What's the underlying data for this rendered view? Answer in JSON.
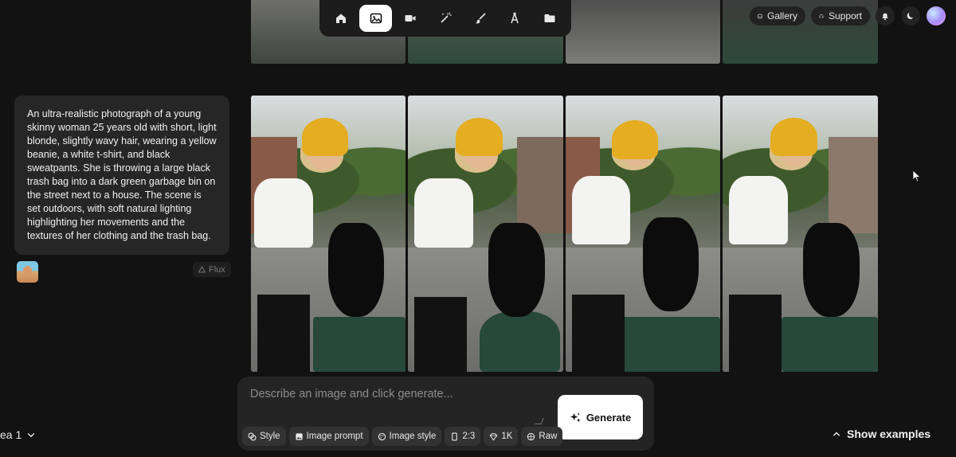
{
  "toolbar": {
    "tools": [
      {
        "name": "home",
        "icon": "home-icon",
        "active": false
      },
      {
        "name": "image",
        "icon": "image-icon",
        "active": true
      },
      {
        "name": "video",
        "icon": "video-icon",
        "active": false
      },
      {
        "name": "magic",
        "icon": "magic-wand-icon",
        "active": false
      },
      {
        "name": "brush",
        "icon": "brush-icon",
        "active": false
      },
      {
        "name": "text",
        "icon": "text-icon",
        "active": false
      },
      {
        "name": "folder",
        "icon": "folder-icon",
        "active": false
      }
    ]
  },
  "header": {
    "gallery_label": "Gallery",
    "support_label": "Support"
  },
  "prompt": {
    "text": "An ultra-realistic photograph of a young skinny woman 25 years old with short, light blonde, slightly wavy hair, wearing a yellow beanie, a white t-shirt, and black sweatpants. She is throwing a large black trash bag into a dark green garbage bin on the street next to a house. The scene is set outdoors, with soft natural lighting highlighting her movements and the textures of her clothing and the trash bag.",
    "model_label": "Flux"
  },
  "composer": {
    "placeholder": "Describe an image and click generate...",
    "generate_label": "Generate",
    "chips": [
      {
        "label": "Style",
        "icon": "style-icon"
      },
      {
        "label": "Image prompt",
        "icon": "image-prompt-icon"
      },
      {
        "label": "Image style",
        "icon": "palette-icon"
      },
      {
        "label": "2:3",
        "icon": "aspect-ratio-icon"
      },
      {
        "label": "1K",
        "icon": "diamond-icon"
      },
      {
        "label": "Raw",
        "icon": "aperture-icon"
      }
    ]
  },
  "footer": {
    "idea_label": "ea 1",
    "show_examples_label": "Show examples"
  },
  "colors": {
    "background": "#121212",
    "panel": "#262626",
    "accent_white": "#ffffff",
    "beanie_yellow": "#e5ad22",
    "bin_green": "#27483a"
  }
}
